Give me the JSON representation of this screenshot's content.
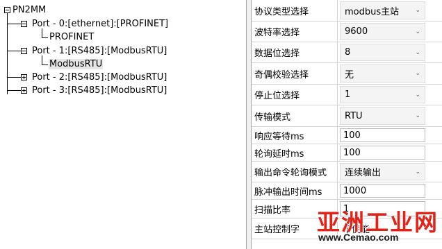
{
  "tree": {
    "root": "PN2MM",
    "ports": [
      {
        "label": "Port - 0:[ethernet]:[PROFINET]",
        "expanded": true,
        "child": "PROFINET"
      },
      {
        "label": "Port - 1:[RS485]:[ModbusRTU]",
        "expanded": true,
        "child": "ModbusRTU"
      },
      {
        "label": "Port - 2:[RS485]:[ModbusRTU]",
        "expanded": false
      },
      {
        "label": "Port - 3:[RS485]:[ModbusRTU]",
        "expanded": false
      }
    ],
    "selected": "ModbusRTU"
  },
  "props": [
    {
      "name": "协议类型选择",
      "value": "modbus主站",
      "kind": "combo"
    },
    {
      "name": "波特率选择",
      "value": "9600",
      "kind": "combo"
    },
    {
      "name": "数据位选择",
      "value": "8",
      "kind": "combo"
    },
    {
      "name": "奇偶校验选择",
      "value": "无",
      "kind": "combo"
    },
    {
      "name": "停止位选择",
      "value": "1",
      "kind": "combo"
    },
    {
      "name": "传输模式",
      "value": "RTU",
      "kind": "combo"
    },
    {
      "name": "响应等待ms",
      "value": "100",
      "kind": "text"
    },
    {
      "name": "轮询延时ms",
      "value": "100",
      "kind": "text"
    },
    {
      "name": "输出命令轮询模式",
      "value": "连续输出",
      "kind": "combo"
    },
    {
      "name": "脉冲输出时间ms",
      "value": "1000",
      "kind": "text"
    },
    {
      "name": "扫描比率",
      "value": "1",
      "kind": "text"
    },
    {
      "name": "主站控制字",
      "value": "不使能",
      "kind": "plain"
    }
  ],
  "watermark": {
    "main": "亚洲工业网",
    "site": "www.Cemao.com"
  }
}
